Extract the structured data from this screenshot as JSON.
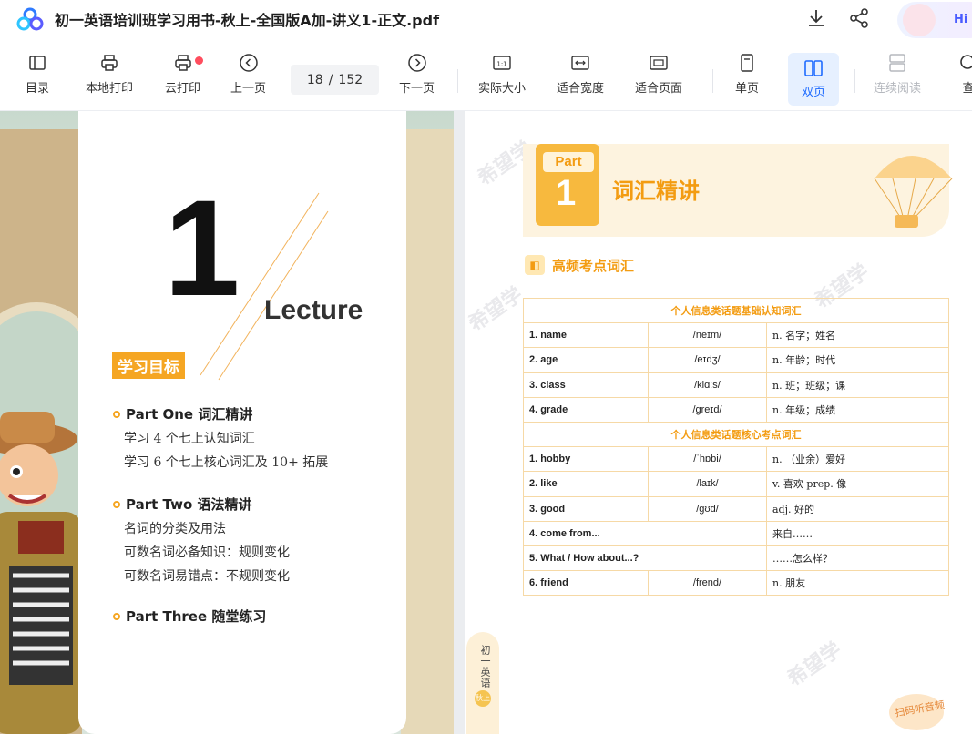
{
  "window": {
    "title": "初一英语培训班学习用书-秋上-全国版A加-讲义1-正文.pdf",
    "greeting": "Hi"
  },
  "toolbar": {
    "catalog": "目录",
    "local_print": "本地打印",
    "cloud_print": "云打印",
    "prev_page": "上一页",
    "current_page": "18",
    "page_sep": "/",
    "total_pages": "152",
    "next_page": "下一页",
    "actual_size": "实际大小",
    "fit_width": "适合宽度",
    "fit_page": "适合页面",
    "single_page": "单页",
    "double_page": "双页",
    "continuous": "连续阅读",
    "search": "查"
  },
  "left_page": {
    "big_number": "1",
    "lecture": "Lecture",
    "goal_tag": "学习目标",
    "parts": [
      {
        "title": "Part One  词汇精讲",
        "lines": [
          "学习 4 个七上认知词汇",
          "学习 6 个七上核心词汇及 10+ 拓展"
        ]
      },
      {
        "title": "Part Two  语法精讲",
        "lines": [
          "名词的分类及用法",
          "可数名词必备知识：规则变化",
          "可数名词易错点：不规则变化"
        ]
      },
      {
        "title": "Part Three  随堂练习",
        "lines": []
      }
    ]
  },
  "right_page": {
    "part_word": "Part",
    "part_number": "1",
    "section_title": "词汇精讲",
    "subhead": "高频考点词汇",
    "table": [
      {
        "caption": "个人信息类话题基础认知词汇"
      },
      {
        "word": "1. name",
        "phonetic": "/neɪm/",
        "meaning": "n. 名字；姓名"
      },
      {
        "word": "2. age",
        "phonetic": "/eɪdʒ/",
        "meaning": "n. 年龄；时代"
      },
      {
        "word": "3. class",
        "phonetic": "/klɑːs/",
        "meaning": "n. 班；班级；课"
      },
      {
        "word": "4. grade",
        "phonetic": "/greɪd/",
        "meaning": "n. 年级；成绩"
      },
      {
        "caption": "个人信息类话题核心考点词汇"
      },
      {
        "word": "1. hobby",
        "phonetic": "/ˈhɒbi/",
        "meaning": "n. （业余）爱好"
      },
      {
        "word": "2. like",
        "phonetic": "/laɪk/",
        "meaning": "v. 喜欢 prep. 像"
      },
      {
        "word": "3. good",
        "phonetic": "/gʊd/",
        "meaning": "adj. 好的"
      },
      {
        "word": "4. come from...",
        "phonetic": "",
        "meaning": "来自……"
      },
      {
        "word": "5. What / How about...?",
        "phonetic": "",
        "meaning": "……怎么样？"
      },
      {
        "word": "6. friend",
        "phonetic": "/frend/",
        "meaning": "n. 朋友"
      }
    ],
    "side_tab": "初一英语",
    "side_tab_badge": "秋上",
    "scan_text": "扫码听音频",
    "watermark": "希望学"
  },
  "colors": {
    "accent": "#f39c12",
    "active_blue": "#1e6bff"
  }
}
